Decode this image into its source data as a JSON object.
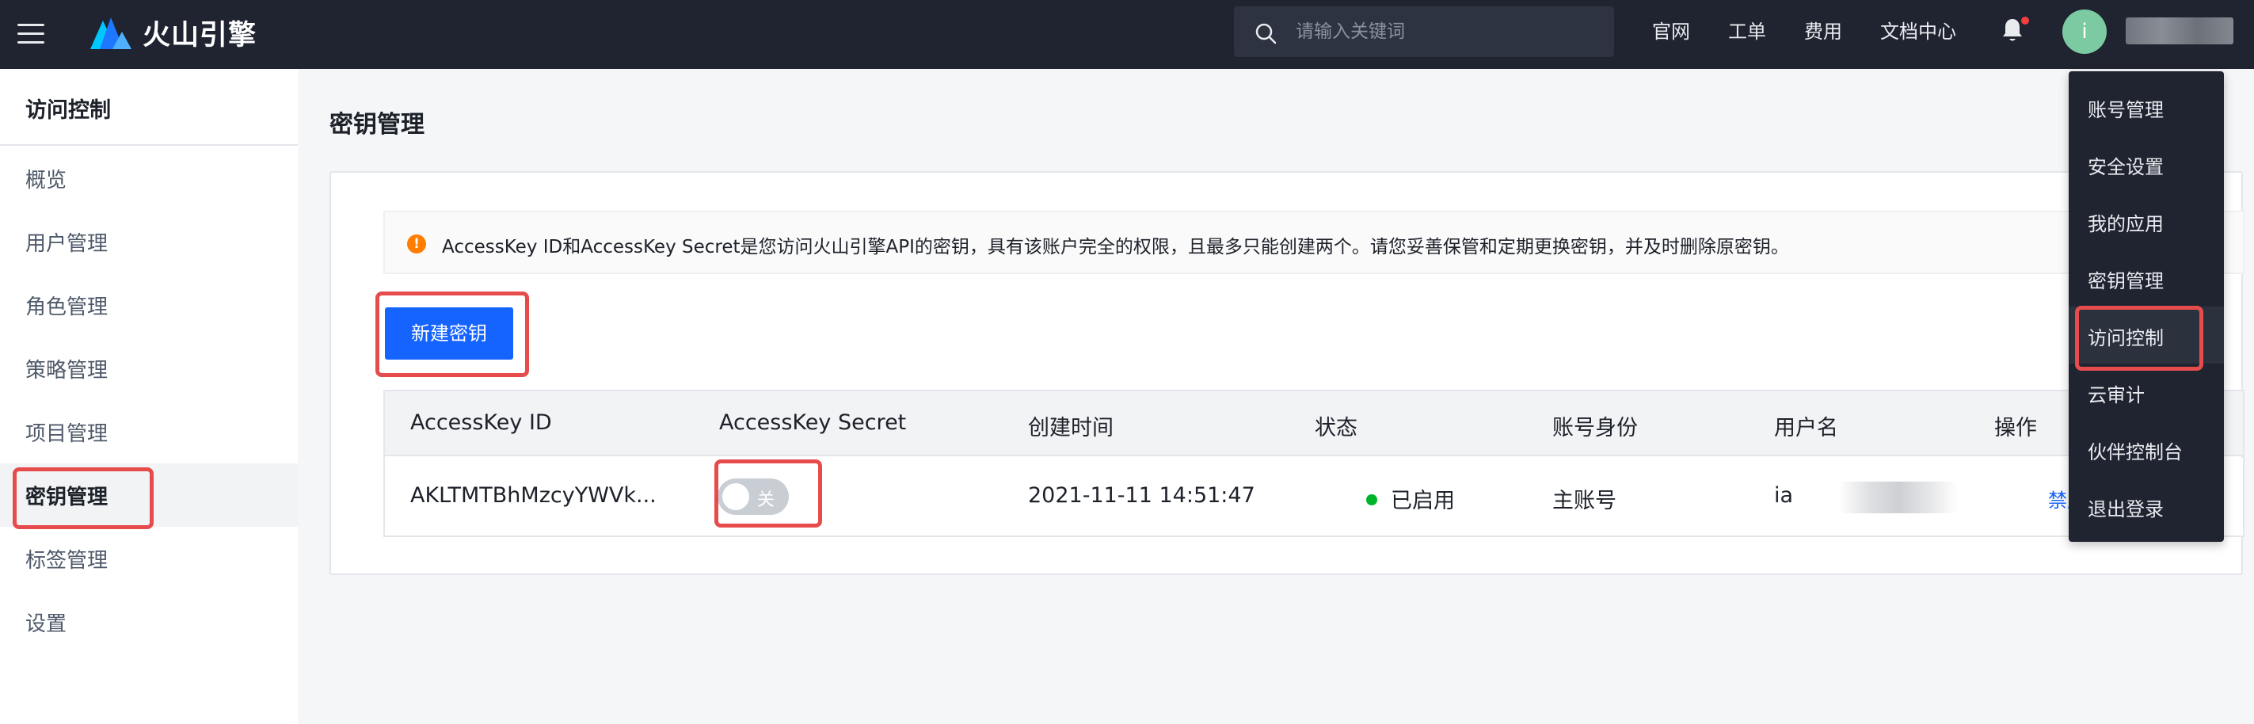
{
  "topbar": {
    "brand": "火山引擎",
    "search_placeholder": "请输入关键词",
    "links": [
      "官网",
      "工单",
      "费用",
      "文档中心"
    ],
    "avatar_initial": "i"
  },
  "sidebar": {
    "title": "访问控制",
    "items": [
      {
        "label": "概览"
      },
      {
        "label": "用户管理"
      },
      {
        "label": "角色管理"
      },
      {
        "label": "策略管理"
      },
      {
        "label": "项目管理"
      },
      {
        "label": "密钥管理"
      },
      {
        "label": "标签管理"
      },
      {
        "label": "设置"
      }
    ],
    "active": "密钥管理"
  },
  "main": {
    "title": "密钥管理",
    "notice": "AccessKey ID和AccessKey Secret是您访问火山引擎API的密钥，具有该账户完全的权限，且最多只能创建两个。请您妥善保管和定期更换密钥，并及时删除原密钥。",
    "new_key_button": "新建密钥",
    "table": {
      "headers": [
        "AccessKey ID",
        "AccessKey Secret",
        "创建时间",
        "状态",
        "账号身份",
        "用户名",
        "操作"
      ],
      "rows": [
        {
          "access_key_id": "AKLTMTBhMzcyYWVk...",
          "secret_toggle": "关",
          "created": "2021-11-11 14:51:47",
          "status": "已启用",
          "identity": "主账号",
          "username": "ia",
          "action": "禁用"
        }
      ]
    }
  },
  "dropdown": {
    "items": [
      "账号管理",
      "安全设置",
      "我的应用",
      "密钥管理",
      "访问控制",
      "云审计",
      "伙伴控制台",
      "退出登录"
    ],
    "highlighted": "访问控制"
  },
  "colors": {
    "topbar_bg": "#1f2430",
    "primary": "#1664ff",
    "highlight": "#e74c4c",
    "status_green": "#00b42a",
    "warning": "#ff7d00"
  }
}
